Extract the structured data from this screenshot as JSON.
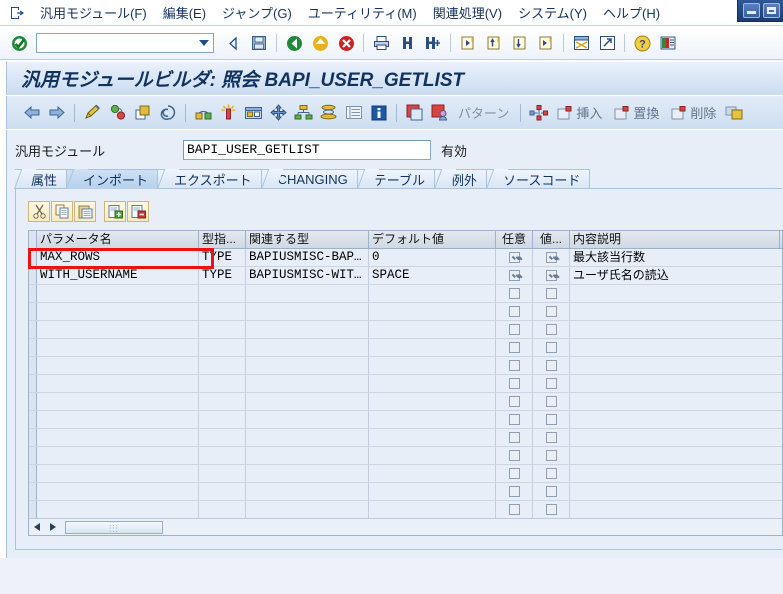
{
  "window": {
    "minimize_title": "最小化",
    "restore_title": "元のサイズに戻す"
  },
  "menubar": {
    "system_icon": "session-icon",
    "items": [
      {
        "label": "汎用モジュール(F)",
        "name": "menu-function-module"
      },
      {
        "label": "編集(E)",
        "name": "menu-edit"
      },
      {
        "label": "ジャンプ(G)",
        "name": "menu-goto"
      },
      {
        "label": "ユーティリティ(M)",
        "name": "menu-utilities"
      },
      {
        "label": "関連処理(V)",
        "name": "menu-environment"
      },
      {
        "label": "システム(Y)",
        "name": "menu-system"
      },
      {
        "label": "ヘルプ(H)",
        "name": "menu-help"
      }
    ]
  },
  "system_toolbar": {
    "command_field_value": "",
    "command_field_placeholder": "",
    "icons": [
      "enter-check-icon",
      "back-arrow-icon",
      "save-icon",
      "back-green-icon",
      "exit-yellow-icon",
      "cancel-red-icon",
      "print-icon",
      "find-icon",
      "find-next-icon",
      "first-page-icon",
      "previous-page-icon",
      "next-page-icon",
      "last-page-icon",
      "new-session-icon",
      "create-shortcut-icon",
      "help-icon",
      "customize-icon"
    ]
  },
  "title": {
    "text": "汎用モジュールビルダ: 照会 BAPI_USER_GETLIST"
  },
  "app_toolbar": {
    "icons": [
      "back-arrow-icon",
      "forward-arrow-icon",
      "display-change-icon",
      "activate-icon",
      "copy-object-icon",
      "where-used-icon",
      "object-navigator-icon",
      "debugging-icon",
      "test-icon",
      "navigate-icon",
      "hierarchy-icon",
      "stack-icon",
      "list-icon",
      "info-icon",
      "stop-icon",
      "user-icon"
    ],
    "pattern_label": "パターン",
    "buttons": [
      {
        "label": "挿入",
        "name": "insert-button"
      },
      {
        "label": "置換",
        "name": "置換-button"
      },
      {
        "label": "削除",
        "name": "delete-button"
      }
    ],
    "trailing_icon": "window-icon"
  },
  "form": {
    "fm_label": "汎用モジュール",
    "fm_value": "BAPI_USER_GETLIST",
    "status": "有効"
  },
  "tabs": [
    {
      "label": "属性",
      "name": "tab-attributes",
      "active": false
    },
    {
      "label": "インポート",
      "name": "tab-import",
      "active": true
    },
    {
      "label": "エクスポート",
      "name": "tab-export",
      "active": false
    },
    {
      "label": "CHANGING",
      "name": "tab-changing",
      "active": false
    },
    {
      "label": "テーブル",
      "name": "tab-tables",
      "active": false
    },
    {
      "label": "例外",
      "name": "tab-exceptions",
      "active": false
    },
    {
      "label": "ソースコード",
      "name": "tab-source-code",
      "active": false
    }
  ],
  "table_toolbar": {
    "icons": [
      {
        "name": "cut-icon"
      },
      {
        "name": "copy-icon"
      },
      {
        "name": "paste-icon"
      },
      {
        "name": "insert-row-icon"
      },
      {
        "name": "delete-row-icon"
      }
    ]
  },
  "grid": {
    "columns": [
      {
        "key": "name",
        "label": "パラメータ名"
      },
      {
        "key": "typing",
        "label": "型指..."
      },
      {
        "key": "reference",
        "label": "関連する型"
      },
      {
        "key": "default",
        "label": "デフォルト値"
      },
      {
        "key": "optional",
        "label": "任意"
      },
      {
        "key": "pass_value",
        "label": "値..."
      },
      {
        "key": "description",
        "label": "内容説明"
      }
    ],
    "rows": [
      {
        "name": "MAX_ROWS",
        "typing": "TYPE",
        "reference": "BAPIUSMISC-BAP…",
        "default": "0",
        "optional": true,
        "pass_value": true,
        "description": "最大該当行数",
        "highlighted": true
      },
      {
        "name": "WITH_USERNAME",
        "typing": "TYPE",
        "reference": "BAPIUSMISC-WIT…",
        "default": "SPACE",
        "optional": true,
        "pass_value": true,
        "description": "ユーザ氏名の読込",
        "highlighted": false
      }
    ],
    "empty_row_count": 14
  },
  "scrollbar": {
    "left_arrow": "scroll-left-icon",
    "right_arrow": "scroll-right-icon",
    "grip": "⋮⋮"
  },
  "annotation": {
    "color": "#ee1111",
    "target": "MAX_ROWS"
  }
}
